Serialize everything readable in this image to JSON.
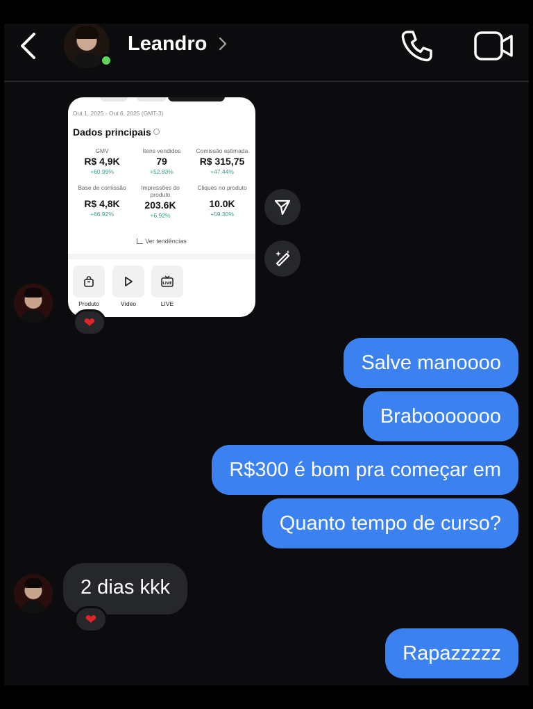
{
  "header": {
    "contact_name": "Leandro",
    "icons": {
      "back": "chevron-left-icon",
      "name_chevron": "chevron-right-icon",
      "call": "phone-icon",
      "video": "video-camera-icon"
    },
    "online_color": "#5fd35a"
  },
  "shared_post": {
    "date_range": "Out 1, 2025 - Out 6, 2025 (GMT-3)",
    "title": "Dados principais",
    "metrics": [
      {
        "label": "GMV",
        "value": "R$ 4,9K",
        "delta": "+60.99%"
      },
      {
        "label": "Itens vendidos",
        "value": "79",
        "delta": "+52.83%"
      },
      {
        "label": "Comissão estimada",
        "value": "R$ 315,75",
        "delta": "+47.44%"
      },
      {
        "label": "Base de comissão",
        "value": "R$ 4,8K",
        "delta": "+66.92%"
      },
      {
        "label": "Impressões do produto",
        "value": "203.6K",
        "delta": "+6.92%"
      },
      {
        "label": "Cliques no produto",
        "value": "10.0K",
        "delta": "+59.30%"
      }
    ],
    "trend_link": "Ver tendências",
    "tiles": [
      {
        "label": "Produto",
        "icon": "shopping-bag-icon"
      },
      {
        "label": "Vídeo",
        "icon": "play-icon"
      },
      {
        "label": "LIVE",
        "icon": "live-tv-icon"
      }
    ],
    "delta_color": "#3a9a8c"
  },
  "side_actions": {
    "share_icon": "send-icon",
    "edit_icon": "magic-pen-icon"
  },
  "messages": {
    "outgoing": [
      "Salve manoooo",
      "Brabooooooo",
      "R$300 é bom pra começar em",
      "Quanto tempo de curso?",
      "Rapazzzzz"
    ],
    "incoming": [
      "2 dias kkk"
    ],
    "reaction": "❤",
    "outgoing_color": "#3b82f0",
    "incoming_color": "#26272b"
  }
}
